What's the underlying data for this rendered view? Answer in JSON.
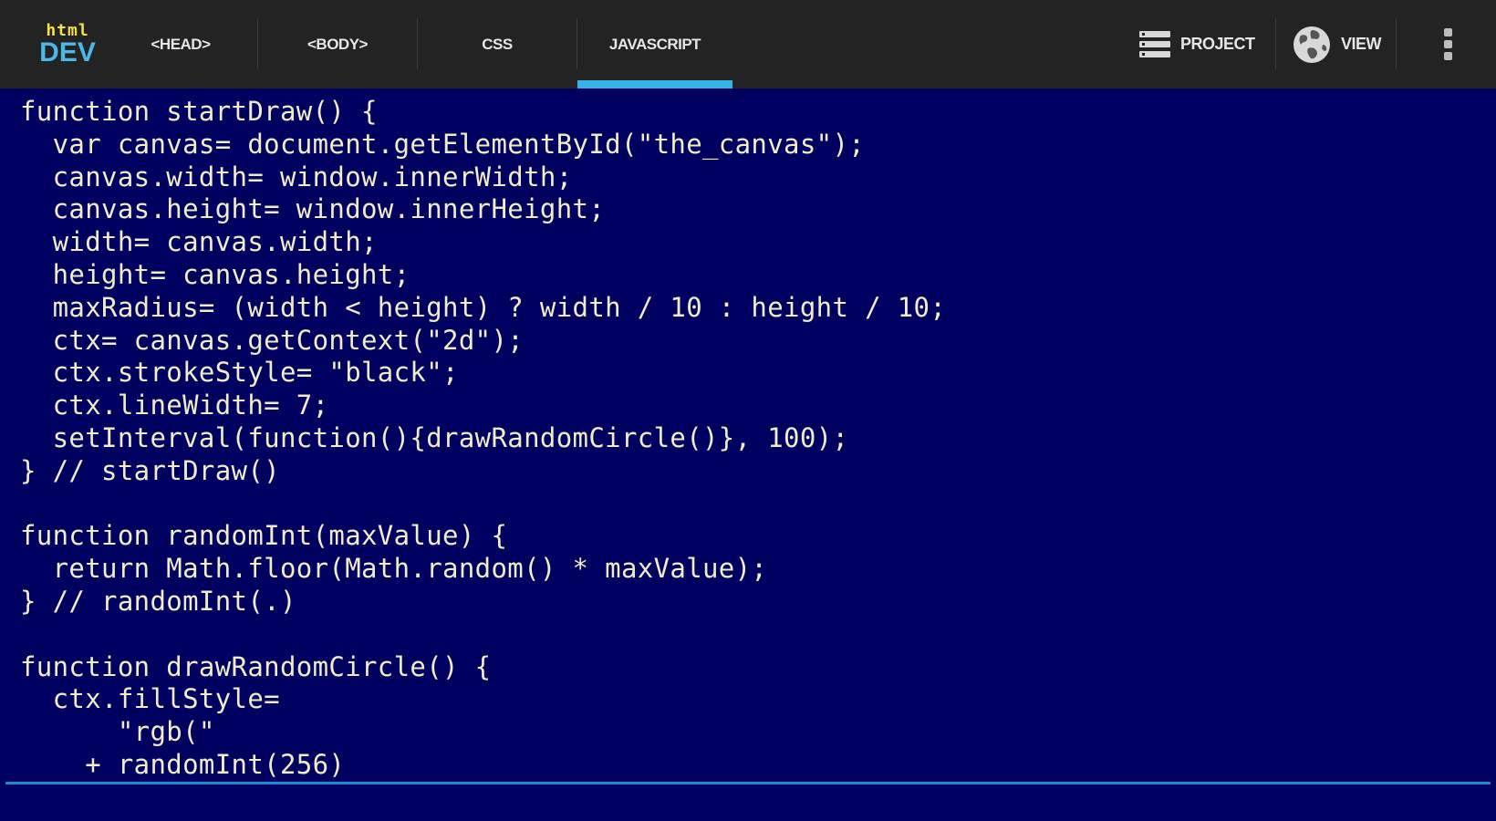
{
  "app": {
    "logo_top": "html",
    "logo_bottom": "DEV"
  },
  "tabs": [
    {
      "label": "<HEAD>",
      "active": false
    },
    {
      "label": "<BODY>",
      "active": false
    },
    {
      "label": "CSS",
      "active": false
    },
    {
      "label": "JAVASCRIPT",
      "active": true
    }
  ],
  "actions": {
    "project_label": "PROJECT",
    "view_label": "VIEW"
  },
  "icons": {
    "project": "list-icon",
    "view": "globe-icon",
    "overflow": "more-vertical-icon"
  },
  "colors": {
    "toolbar_bg": "#232323",
    "accent": "#33b5e5",
    "editor_bg": "#000060",
    "code_text": "#f2ecc6",
    "logo_top": "#f4e04a",
    "logo_bottom": "#4ab8e8"
  },
  "editor": {
    "code": "function startDraw() {\n  var canvas= document.getElementById(\"the_canvas\");\n  canvas.width= window.innerWidth;\n  canvas.height= window.innerHeight;\n  width= canvas.width;\n  height= canvas.height;\n  maxRadius= (width < height) ? width / 10 : height / 10;\n  ctx= canvas.getContext(\"2d\");\n  ctx.strokeStyle= \"black\";\n  ctx.lineWidth= 7;\n  setInterval(function(){drawRandomCircle()}, 100);\n} // startDraw()\n\nfunction randomInt(maxValue) {\n  return Math.floor(Math.random() * maxValue);\n} // randomInt(.)\n\nfunction drawRandomCircle() {\n  ctx.fillStyle=\n      \"rgb(\"\n    + randomInt(256)"
  }
}
